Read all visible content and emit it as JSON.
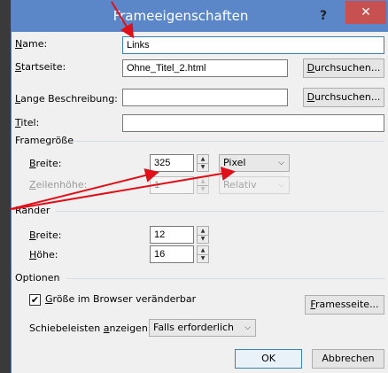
{
  "dialog": {
    "title": "Frameeigenschaften",
    "help_label": "?",
    "close_label": "✕"
  },
  "fields": {
    "name": {
      "label_ul": "N",
      "label_rest": "ame:",
      "value": "Links"
    },
    "startseite": {
      "label_ul": "S",
      "label_rest": "tartseite:",
      "value": "Ohne_Titel_2.html",
      "button_ul": "D",
      "button_rest": "urchsuchen..."
    },
    "lange": {
      "label_ul": "L",
      "label_rest": "ange Beschreibung:",
      "value": "",
      "button_ul": "D",
      "button_rest": "urchsuchen..."
    },
    "titel": {
      "label_ul": "T",
      "label_rest": "itel:",
      "value": ""
    }
  },
  "framegroesse": {
    "group_label": "Framegröße",
    "breite": {
      "label_ul": "B",
      "label_rest": "reite:",
      "value": "325",
      "unit": "Pixel"
    },
    "zeilenhoehe": {
      "label_ul": "Z",
      "label_rest": "eilenhöhe:",
      "value": "1",
      "unit": "Relativ"
    }
  },
  "raender": {
    "group_label": "Ränder",
    "breite": {
      "label_ul": "B",
      "label_rest": "reite:",
      "value": "12"
    },
    "hoehe": {
      "label_ul": "H",
      "label_rest": "öhe:",
      "value": "16"
    }
  },
  "optionen": {
    "group_label": "Optionen",
    "resize": {
      "label_ul": "G",
      "label_rest": "röße im Browser veränderbar",
      "checked": true,
      "check_glyph": "✔"
    },
    "frameset_button_ul": "F",
    "frameset_button_rest": "ramesseite...",
    "scroll_label_a": "Schiebeleisten ",
    "scroll_label_ul": "a",
    "scroll_label_b": "nzeigen:",
    "scroll_value": "Falls erforderlich"
  },
  "footer": {
    "ok_label": "OK",
    "cancel_label": "Abbrechen"
  },
  "icons": {
    "chevron": "⌵",
    "spin_up": "▲",
    "spin_down": "▼"
  },
  "colors": {
    "titlebar": "#5b87c9",
    "close": "#c75050",
    "arrow": "#e0101a"
  }
}
